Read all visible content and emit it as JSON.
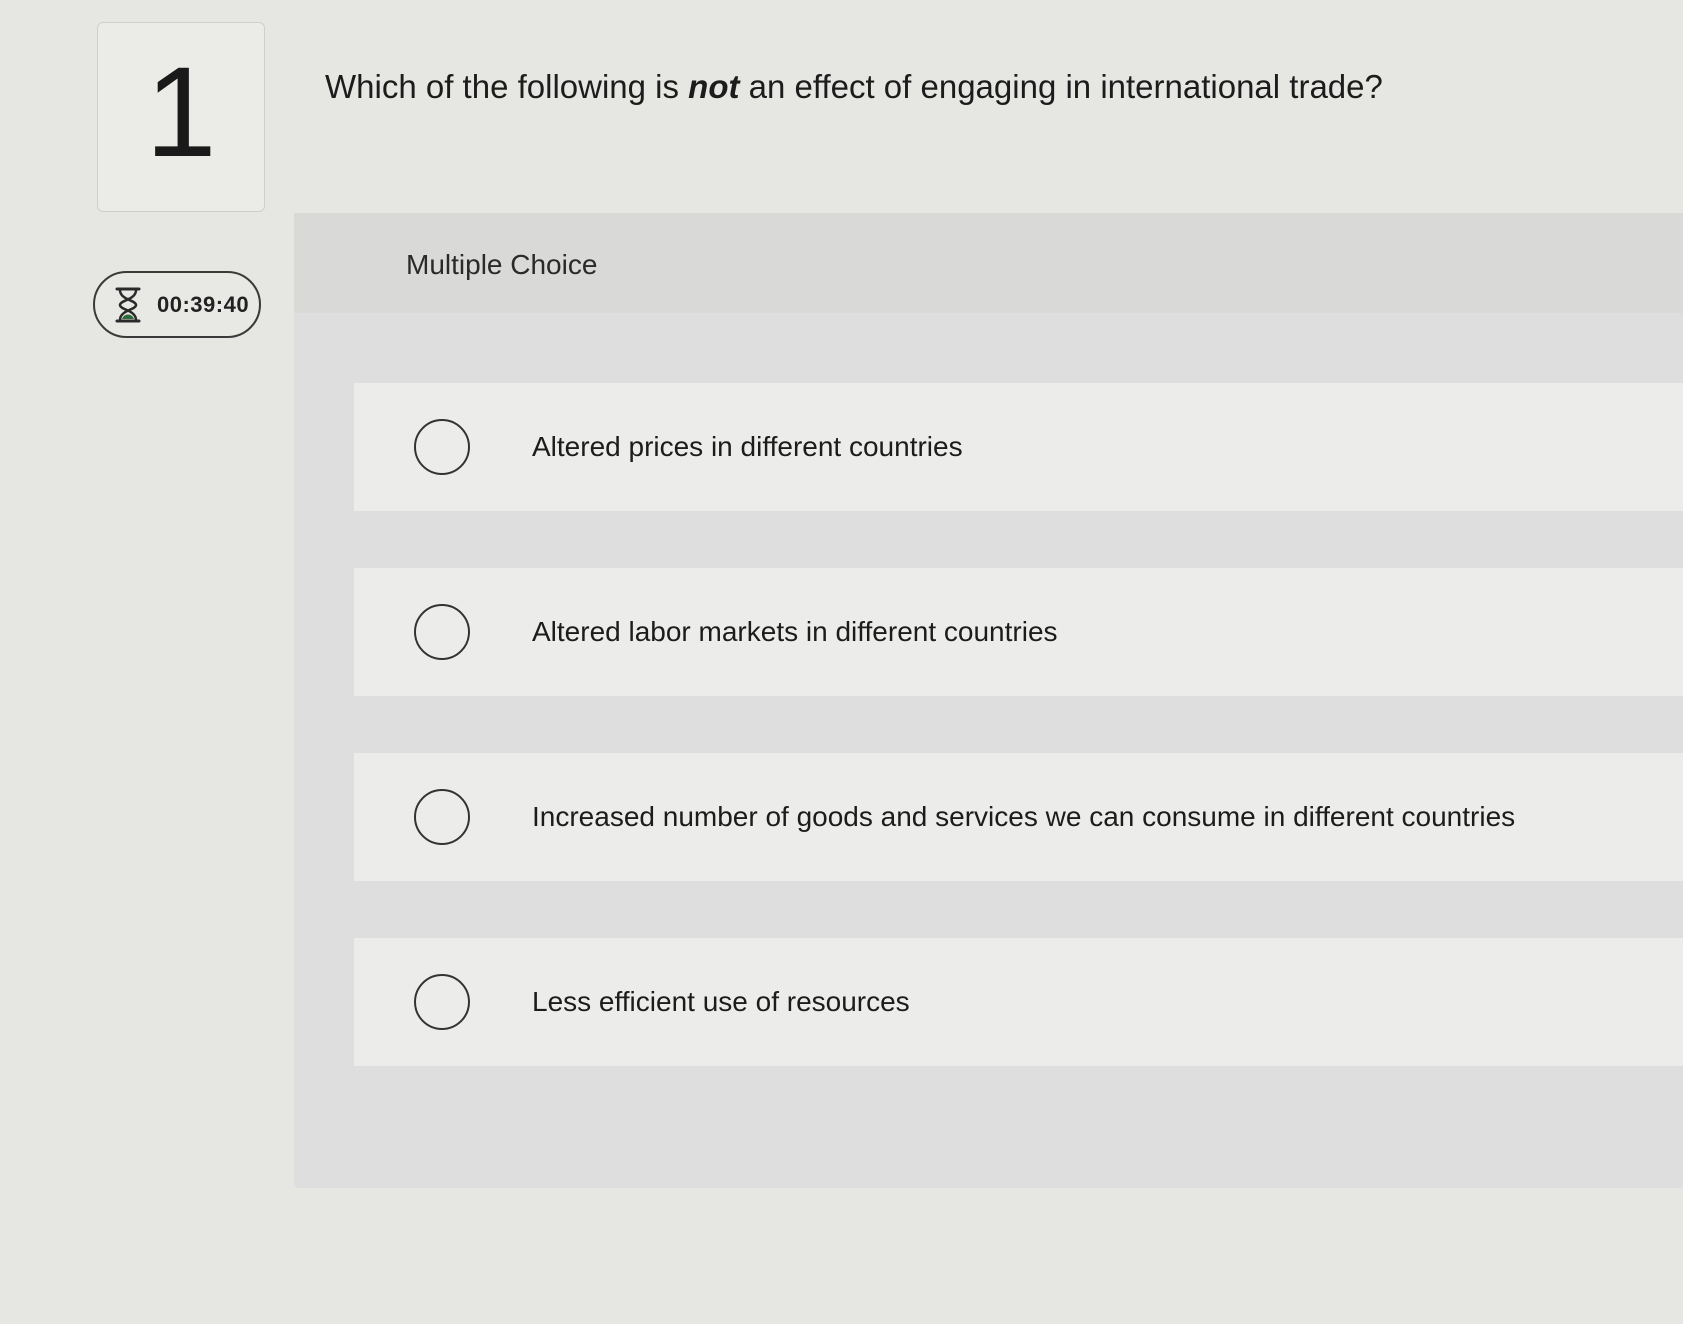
{
  "question": {
    "number": "1",
    "text_before": "Which of the following is ",
    "text_emphasis": "not",
    "text_after": " an effect of engaging in international trade?"
  },
  "timer": {
    "icon": "hourglass-icon",
    "value": "00:39:40"
  },
  "panel": {
    "title": "Multiple Choice"
  },
  "choices": [
    {
      "label": "Altered prices in different countries",
      "selected": false
    },
    {
      "label": "Altered labor markets in different countries",
      "selected": false
    },
    {
      "label": "Increased number of goods and services we can consume in different countries",
      "selected": false
    },
    {
      "label": "Less efficient use of resources",
      "selected": false
    }
  ]
}
